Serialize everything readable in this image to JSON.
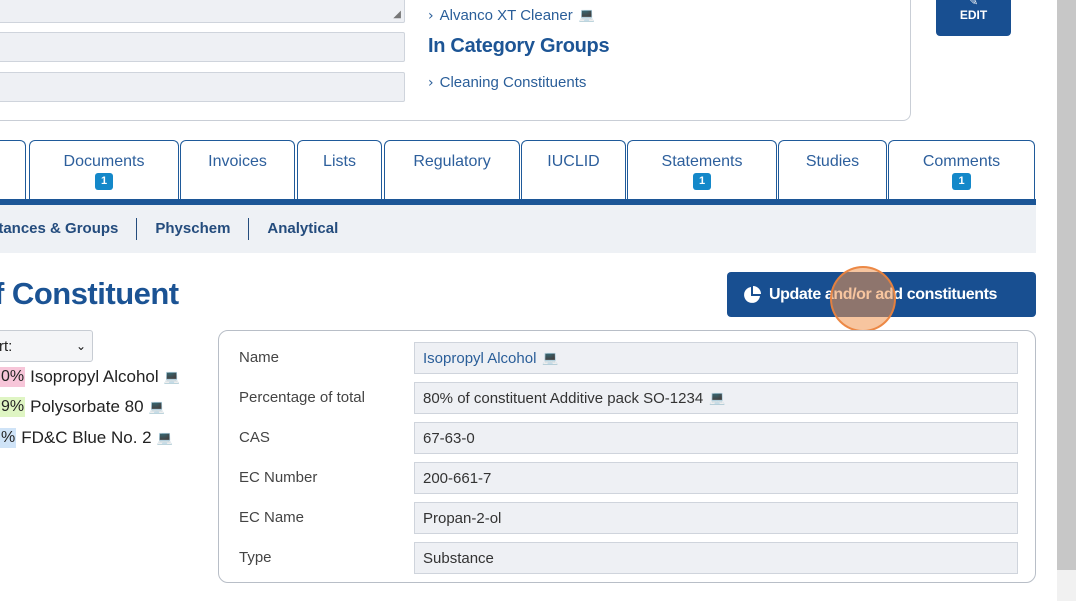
{
  "top_card": {
    "links": [
      {
        "label": "Alvanco XT Cleaner",
        "icon": "laptop-icon"
      },
      {
        "label": "Cleaning Constituents",
        "icon": ""
      }
    ],
    "category_heading": "In Category Groups",
    "edit_label": "EDIT"
  },
  "tabs": [
    {
      "label": "Documents",
      "badge": "1"
    },
    {
      "label": "Invoices",
      "badge": ""
    },
    {
      "label": "Lists",
      "badge": ""
    },
    {
      "label": "Regulatory",
      "badge": ""
    },
    {
      "label": "IUCLID",
      "badge": ""
    },
    {
      "label": "Statements",
      "badge": "1"
    },
    {
      "label": "Studies",
      "badge": ""
    },
    {
      "label": "Comments",
      "badge": "1"
    }
  ],
  "subnav": [
    "stances & Groups",
    "Physchem",
    "Analytical"
  ],
  "page_title": "f Constituent",
  "update_button": {
    "label": "Update and/or add constituents",
    "icon": "pie-chart-icon"
  },
  "sort": {
    "value": "rt:"
  },
  "constituents": [
    {
      "pct": "0%",
      "name": "Isopropyl Alcohol",
      "color": "#f7c6d9"
    },
    {
      "pct": "9%",
      "name": "Polysorbate 80",
      "color": "#dff5c3"
    },
    {
      "pct": "%",
      "name": "FD&C Blue No. 2",
      "color": "#cfe3f7"
    }
  ],
  "details": [
    {
      "label": "Name",
      "value": "Isopropyl Alcohol",
      "link": true,
      "laptop": true
    },
    {
      "label": "Percentage of total",
      "value": "80% of constituent Additive pack SO-1234",
      "link": false,
      "laptop": true
    },
    {
      "label": "CAS",
      "value": "67-63-0",
      "link": false,
      "laptop": false
    },
    {
      "label": "EC Number",
      "value": "200-661-7",
      "link": false,
      "laptop": false
    },
    {
      "label": "EC Name",
      "value": "Propan-2-ol",
      "link": false,
      "laptop": false
    },
    {
      "label": "Type",
      "value": "Substance",
      "link": false,
      "laptop": false
    }
  ],
  "colors": {
    "brand": "#184f91",
    "badge": "#1488c9",
    "link": "#2a5e99"
  }
}
